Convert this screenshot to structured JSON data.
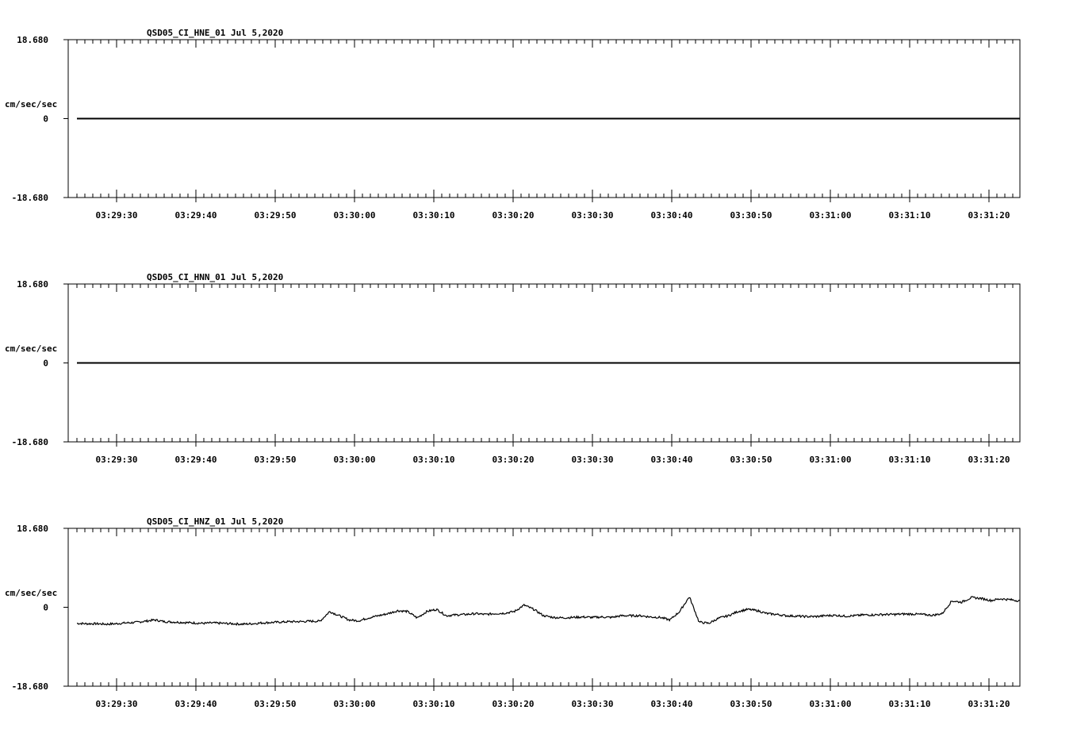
{
  "chart_data": [
    {
      "type": "line",
      "title": "QSD05_CI_HNE_01  Jul 5,2020",
      "ylabel": "cm/sec/sec",
      "ylim": [
        -18.68,
        18.68
      ],
      "y_tick_labels": [
        "18.680",
        "0",
        "-18.680"
      ],
      "x_tick_labels": [
        "03:29:30",
        "03:29:40",
        "03:29:50",
        "03:30:00",
        "03:30:10",
        "03:30:20",
        "03:30:30",
        "03:30:40",
        "03:30:50",
        "03:31:00",
        "03:31:10",
        "03:31:20"
      ],
      "series": [
        {
          "values": [
            0,
            0
          ]
        }
      ]
    },
    {
      "type": "line",
      "title": "QSD05_CI_HNN_01  Jul 5,2020",
      "ylabel": "cm/sec/sec",
      "ylim": [
        -18.68,
        18.68
      ],
      "y_tick_labels": [
        "18.680",
        "0",
        "-18.680"
      ],
      "x_tick_labels": [
        "03:29:30",
        "03:29:40",
        "03:29:50",
        "03:30:00",
        "03:30:10",
        "03:30:20",
        "03:30:30",
        "03:30:40",
        "03:30:50",
        "03:31:00",
        "03:31:10",
        "03:31:20"
      ],
      "series": [
        {
          "values": [
            0,
            0
          ]
        }
      ]
    },
    {
      "type": "line",
      "title": "QSD05_CI_HNZ_01  Jul 5,2020",
      "ylabel": "cm/sec/sec",
      "ylim": [
        -18.68,
        18.68
      ],
      "y_tick_labels": [
        "18.680",
        "0",
        "-18.680"
      ],
      "x_tick_labels": [
        "03:29:30",
        "03:29:40",
        "03:29:50",
        "03:30:00",
        "03:30:10",
        "03:30:20",
        "03:30:30",
        "03:30:40",
        "03:30:50",
        "03:31:00",
        "03:31:10",
        "03:31:20"
      ],
      "series": [
        {
          "values": [
            -3.8,
            -3.9,
            -3.9,
            -4.0,
            -3.9,
            -3.7,
            -3.6,
            -3.3,
            -3.0,
            -3.4,
            -3.5,
            -3.6,
            -3.7,
            -3.8,
            -3.7,
            -3.8,
            -3.9,
            -4.0,
            -3.9,
            -3.7,
            -3.6,
            -3.5,
            -3.4,
            -3.4,
            -3.3,
            -3.3,
            -1.0,
            -2.0,
            -3.0,
            -3.2,
            -2.5,
            -2.0,
            -1.5,
            -0.8,
            -1.0,
            -2.5,
            -1.0,
            -0.5,
            -2.0,
            -1.8,
            -1.7,
            -1.5,
            -1.7,
            -1.5,
            -1.4,
            -1.0,
            0.5,
            -0.5,
            -2.0,
            -2.4,
            -2.5,
            -2.4,
            -2.3,
            -2.4,
            -2.3,
            -2.4,
            -2.0,
            -2.0,
            -2.0,
            -2.3,
            -2.4,
            -3.0,
            -1.0,
            2.5,
            -3.5,
            -3.8,
            -2.6,
            -2.0,
            -1.0,
            -0.5,
            -0.8,
            -1.5,
            -1.7,
            -2.0,
            -2.1,
            -2.2,
            -2.2,
            -2.0,
            -1.9,
            -2.1,
            -2.0,
            -1.8,
            -1.8,
            -1.7,
            -1.7,
            -1.6,
            -1.6,
            -1.7,
            -1.9,
            -1.5,
            1.5,
            1.2,
            2.3,
            2.1,
            1.6,
            2.0,
            1.8,
            1.5
          ]
        }
      ]
    }
  ]
}
